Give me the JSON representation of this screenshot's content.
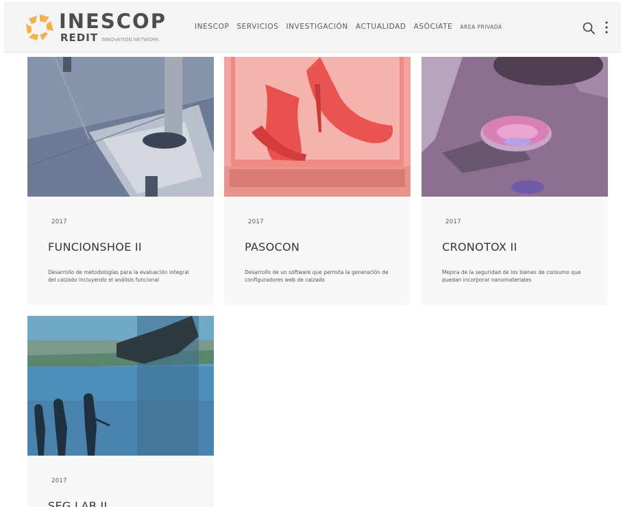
{
  "brand": {
    "title": "INESCOP",
    "sub_bold": "REDIT",
    "sub_small": "INNOVATION NETWORK",
    "accent_color": "#f0b24a",
    "text_color": "#4d4d4d"
  },
  "nav": {
    "items": [
      {
        "label": "INESCOP"
      },
      {
        "label": "SERVICIOS"
      },
      {
        "label": "INVESTIGACIÓN"
      },
      {
        "label": "ACTUALIDAD"
      },
      {
        "label": "ASÓCIATE"
      },
      {
        "label": "ÁREA PRIVADA"
      }
    ],
    "icons": [
      "search-icon",
      "more-vertical-icon"
    ]
  },
  "projects": [
    {
      "year": "2017",
      "title": "FUNCIONSHOE II",
      "description": "Desarrollo de metodologías para la evaluación integral del calzado incluyendo el análisis funcional",
      "image_tint": "#5b6b8c"
    },
    {
      "year": "2017",
      "title": "PASOCON",
      "description": "Desarrollo de un software que permita la generación de configuradores web de calzado",
      "image_tint": "#f29a94"
    },
    {
      "year": "2017",
      "title": "CRONOTOX II",
      "description": "Mejora de la seguridad de los bienes de consumo que puedan incorporar nanomateriales",
      "image_tint": "#8c6a8e"
    },
    {
      "year": "2017",
      "title": "SEG LAB II",
      "description": "",
      "image_tint": "#4f86a8"
    }
  ]
}
